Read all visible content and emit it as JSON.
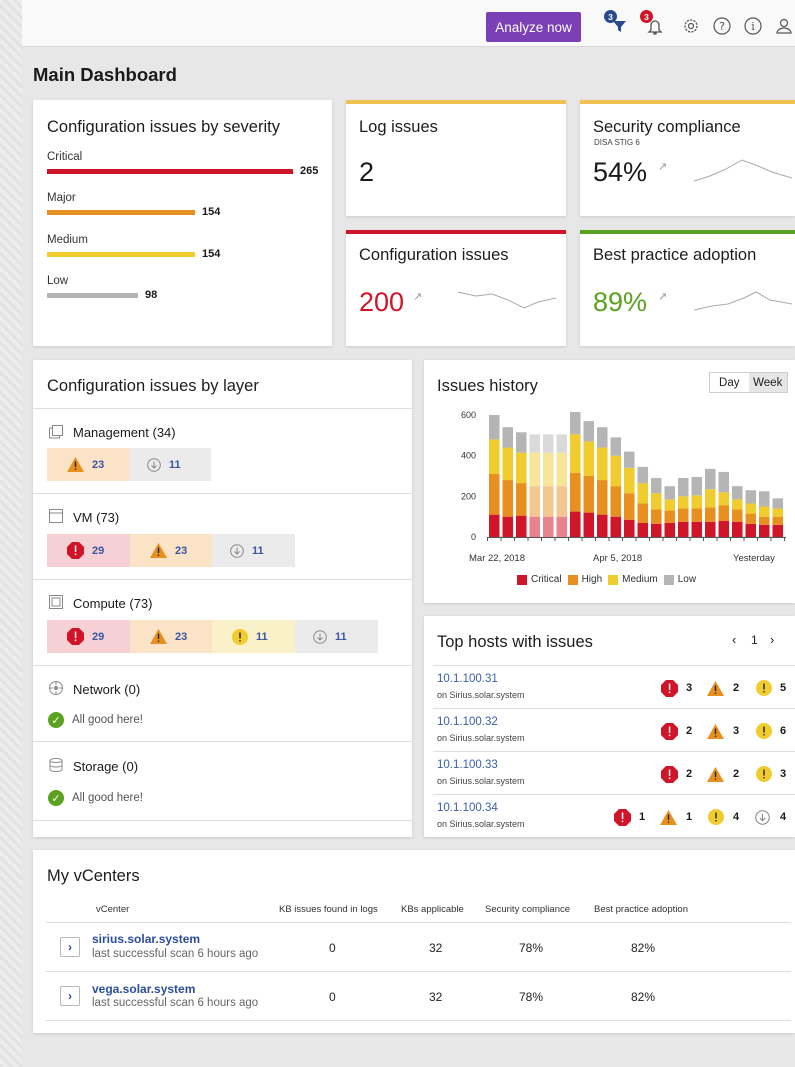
{
  "toolbar": {
    "analyze_label": "Analyze now",
    "filter_badge": "3",
    "alerts_badge": "3",
    "icons": [
      "filter-icon",
      "bell-icon",
      "settings-icon",
      "help-icon",
      "info-icon",
      "user-icon"
    ]
  },
  "page_title": "Main Dashboard",
  "severity": {
    "title": "Configuration issues by severity",
    "items": [
      {
        "label": "Critical",
        "value": "265",
        "color": "#d0152a",
        "fraction": 1.0
      },
      {
        "label": "Major",
        "value": "154",
        "color": "#e8901f",
        "fraction": 0.58
      },
      {
        "label": "Medium",
        "value": "154",
        "color": "#f0cc2e",
        "fraction": 0.58
      },
      {
        "label": "Low",
        "value": "98",
        "color": "#b5b5b5",
        "fraction": 0.37
      }
    ]
  },
  "log_issues": {
    "title": "Log issues",
    "value": "2",
    "accent": "#f0c050"
  },
  "security_compliance": {
    "title": "Security compliance",
    "subtitle": "DISA STIG 6",
    "value": "54%",
    "arrow": "↗",
    "accent": "#f0c050"
  },
  "config_issues": {
    "title": "Configuration issues",
    "value": "200",
    "arrow": "↗",
    "accent": "#d0152a",
    "value_color": "#d0152a"
  },
  "best_practice": {
    "title": "Best practice adoption",
    "value": "89%",
    "arrow": "↗",
    "accent": "#5aa220",
    "value_color": "#5aa220"
  },
  "layers": {
    "title": "Configuration issues by layer",
    "items": [
      {
        "name": "Management (34)",
        "icon": "management-icon",
        "cells": [
          "23",
          "11"
        ]
      },
      {
        "name": "VM (73)",
        "icon": "vm-icon",
        "cells": [
          "29",
          "23",
          "11"
        ]
      },
      {
        "name": "Compute (73)",
        "icon": "compute-icon",
        "cells": [
          "29",
          "23",
          "11",
          "11"
        ]
      },
      {
        "name": "Network (0)",
        "icon": "network-icon",
        "good": "All good here!"
      },
      {
        "name": "Storage (0)",
        "icon": "storage-icon",
        "good": "All good here!"
      }
    ]
  },
  "history": {
    "title": "Issues history",
    "toggle": [
      "Day",
      "Week"
    ],
    "selected": "Day"
  },
  "chart_data": {
    "type": "bar",
    "stacked": true,
    "title": "Issues history",
    "ylim": [
      0,
      600
    ],
    "yticks": [
      "600",
      "400",
      "200",
      "0"
    ],
    "x_labels": [
      "Mar 22, 2018",
      "Apr 5, 2018",
      "Yesterday"
    ],
    "series": [
      {
        "name": "Critical",
        "color": "#d0152a",
        "values": [
          110,
          100,
          105,
          100,
          100,
          100,
          125,
          120,
          110,
          100,
          85,
          70,
          65,
          70,
          75,
          75,
          75,
          80,
          75,
          65,
          60,
          60
        ]
      },
      {
        "name": "High",
        "color": "#e8901f",
        "values": [
          200,
          180,
          160,
          150,
          150,
          150,
          190,
          180,
          170,
          150,
          130,
          95,
          70,
          60,
          65,
          65,
          70,
          75,
          60,
          50,
          40,
          40
        ]
      },
      {
        "name": "Medium",
        "color": "#f0cc2e",
        "values": [
          170,
          160,
          150,
          165,
          165,
          165,
          190,
          170,
          160,
          150,
          125,
          100,
          80,
          55,
          60,
          65,
          90,
          65,
          50,
          50,
          50,
          40
        ]
      },
      {
        "name": "Low",
        "color": "#b5b5b5",
        "values": [
          120,
          100,
          100,
          90,
          90,
          90,
          110,
          100,
          100,
          90,
          80,
          80,
          75,
          65,
          90,
          90,
          100,
          100,
          65,
          65,
          75,
          50
        ]
      }
    ],
    "faded_indices": [
      3,
      4,
      5
    ],
    "legend_position": "bottom"
  },
  "hosts": {
    "title": "Top hosts with issues",
    "page": "1",
    "prev": "‹",
    "next": "›",
    "items": [
      {
        "ip": "10.1.100.31",
        "sub": "on Sirius.solar.system",
        "critical": "3",
        "warning": "2",
        "medium": "5"
      },
      {
        "ip": "10.1.100.32",
        "sub": "on Sirius.solar.system",
        "critical": "2",
        "warning": "3",
        "medium": "6"
      },
      {
        "ip": "10.1.100.33",
        "sub": "on Sirius.solar.system",
        "critical": "2",
        "warning": "2",
        "medium": "3"
      },
      {
        "ip": "10.1.100.34",
        "sub": "on Sirius.solar.system",
        "critical": "1",
        "warning": "1",
        "medium": "4",
        "low": "4"
      }
    ]
  },
  "vcenters": {
    "title": "My vCenters",
    "columns": [
      "vCenter",
      "KB issues found in logs",
      "KBs applicable",
      "Security compliance",
      "Best practice adoption"
    ],
    "rows": [
      {
        "name": "sirius.solar.system",
        "sub": "last successful scan 6 hours ago",
        "kb_logs": "0",
        "kbs": "32",
        "security": "78%",
        "best": "82%"
      },
      {
        "name": "vega.solar.system",
        "sub": "last successful scan 6 hours ago",
        "kb_logs": "0",
        "kbs": "32",
        "security": "78%",
        "best": "82%"
      }
    ]
  }
}
